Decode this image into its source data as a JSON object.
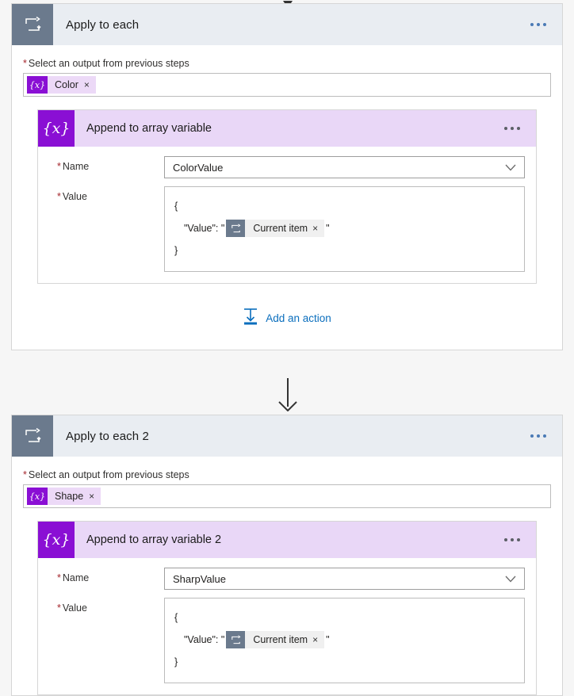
{
  "theme": {
    "page_bg": "#f6f6f6",
    "scope_header_bg": "#e9edf2",
    "scope_icon_bg": "#6b7a8d",
    "action_header_bg": "#e9d7f7",
    "action_icon_bg": "#8a0fd4",
    "token_bg": "#ecd9f7",
    "link_blue": "#0a6ebd",
    "required_red": "#a4262c"
  },
  "icons": {
    "loop": "loop-icon",
    "variable": "{x}",
    "ellipsis": "more-options-icon",
    "chevron_down": "chevron-down-icon",
    "add_action": "insert-action-icon",
    "remove": "×"
  },
  "scopes": [
    {
      "title": "Apply to each",
      "icon": "loop-icon",
      "more_label": "...",
      "output_field": {
        "required_mark": "*",
        "label": "Select an output from previous steps",
        "token": {
          "icon": "{x}",
          "label": "Color",
          "remove": "×"
        }
      },
      "action": {
        "title": "Append to array variable",
        "icon": "{x}",
        "more_label": "...",
        "fields": {
          "name": {
            "required_mark": "*",
            "label": "Name",
            "value": "ColorValue"
          },
          "value": {
            "required_mark": "*",
            "label": "Value",
            "line_open": "{",
            "line_key": "\"Value\": \"",
            "token": {
              "icon": "loop-icon",
              "label": "Current item",
              "remove": "×"
            },
            "line_close_quote": "\"",
            "line_close": "}"
          }
        }
      },
      "add_action": {
        "label": "Add an action",
        "icon": "insert-action-icon"
      }
    },
    {
      "title": "Apply to each 2",
      "icon": "loop-icon",
      "more_label": "...",
      "output_field": {
        "required_mark": "*",
        "label": "Select an output from previous steps",
        "token": {
          "icon": "{x}",
          "label": "Shape",
          "remove": "×"
        }
      },
      "action": {
        "title": "Append to array variable 2",
        "icon": "{x}",
        "more_label": "...",
        "fields": {
          "name": {
            "required_mark": "*",
            "label": "Name",
            "value": "SharpValue"
          },
          "value": {
            "required_mark": "*",
            "label": "Value",
            "line_open": "{",
            "line_key": "\"Value\": \"",
            "token": {
              "icon": "loop-icon",
              "label": "Current item",
              "remove": "×"
            },
            "line_close_quote": "\"",
            "line_close": "}"
          }
        }
      }
    }
  ]
}
